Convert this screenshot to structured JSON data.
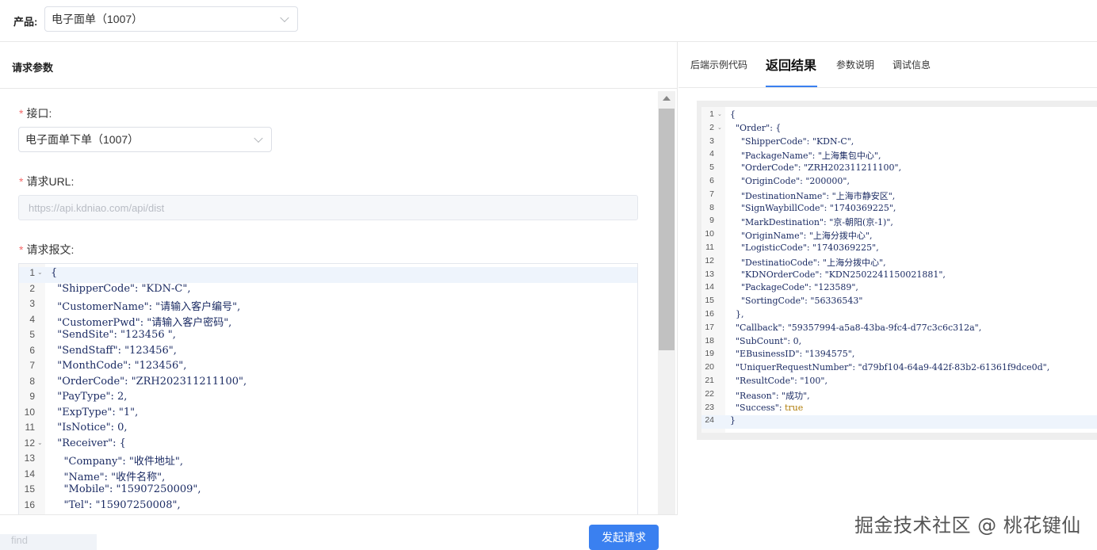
{
  "product": {
    "label": "产品:",
    "selected": "电子面单（1007）",
    "chevron_icon": "chevron-down-icon"
  },
  "left_panel": {
    "title": "请求参数",
    "interface": {
      "label": "接口:",
      "selected": "电子面单下单（1007）"
    },
    "url": {
      "label": "请求URL:",
      "value": "https://api.kdniao.com/api/dist"
    },
    "body": {
      "label": "请求报文:",
      "lines": [
        "{",
        "  \"ShipperCode\": \"KDN-C\",",
        "  \"CustomerName\": \"请输入客户编号\",",
        "  \"CustomerPwd\": \"请输入客户密码\",",
        "  \"SendSite\": \"123456 \",",
        "  \"SendStaff\": \"123456\",",
        "  \"MonthCode\": \"123456\",",
        "  \"OrderCode\": \"ZRH202311211100\",",
        "  \"PayType\": 2,",
        "  \"ExpType\": \"1\",",
        "  \"IsNotice\": 0,",
        "  \"Receiver\": {",
        "    \"Company\": \"收件地址\",",
        "    \"Name\": \"收件名称\",",
        "    \"Mobile\": \"15907250009\",",
        "    \"Tel\": \"15907250008\","
      ],
      "line_numbers": [
        "1",
        "2",
        "3",
        "4",
        "5",
        "6",
        "7",
        "8",
        "9",
        "10",
        "11",
        "12",
        "13",
        "14",
        "15",
        "16"
      ]
    },
    "send_button": "发起请求",
    "find_placeholder": "find"
  },
  "right_panel": {
    "tabs": [
      "后端示例代码",
      "返回结果",
      "参数说明",
      "调试信息"
    ],
    "active_tab": "返回结果",
    "response_lines": [
      "{",
      "  \"Order\": {",
      "    \"ShipperCode\": \"KDN-C\",",
      "    \"PackageName\": \"上海集包中心\",",
      "    \"OrderCode\": \"ZRH202311211100\",",
      "    \"OriginCode\": \"200000\",",
      "    \"DestinationName\": \"上海市静安区\",",
      "    \"SignWaybillCode\": \"1740369225\",",
      "    \"MarkDestination\": \"京-朝阳(京-1)\",",
      "    \"OriginName\": \"上海分拨中心\",",
      "    \"LogisticCode\": \"1740369225\",",
      "    \"DestinatioCode\": \"上海分拨中心\",",
      "    \"KDNOrderCode\": \"KDN2502241150021881\",",
      "    \"PackageCode\": \"123589\",",
      "    \"SortingCode\": \"56336543\"",
      "  },",
      "  \"Callback\": \"59357994-a5a8-43ba-9fc4-d77c3c6c312a\",",
      "  \"SubCount\": 0,",
      "  \"EBusinessID\": \"1394575\",",
      "  \"UniquerRequestNumber\": \"d79bf104-64a9-442f-83b2-61361f9dce0d\",",
      "  \"ResultCode\": \"100\",",
      "  \"Reason\": \"成功\",",
      "  \"Success\": ",
      "}"
    ],
    "success_value": "true",
    "line_numbers": [
      "1",
      "2",
      "3",
      "4",
      "5",
      "6",
      "7",
      "8",
      "9",
      "10",
      "11",
      "12",
      "13",
      "14",
      "15",
      "16",
      "17",
      "18",
      "19",
      "20",
      "21",
      "22",
      "23",
      "24"
    ]
  },
  "watermark": "掘金技术社区 @ 桃花键仙"
}
